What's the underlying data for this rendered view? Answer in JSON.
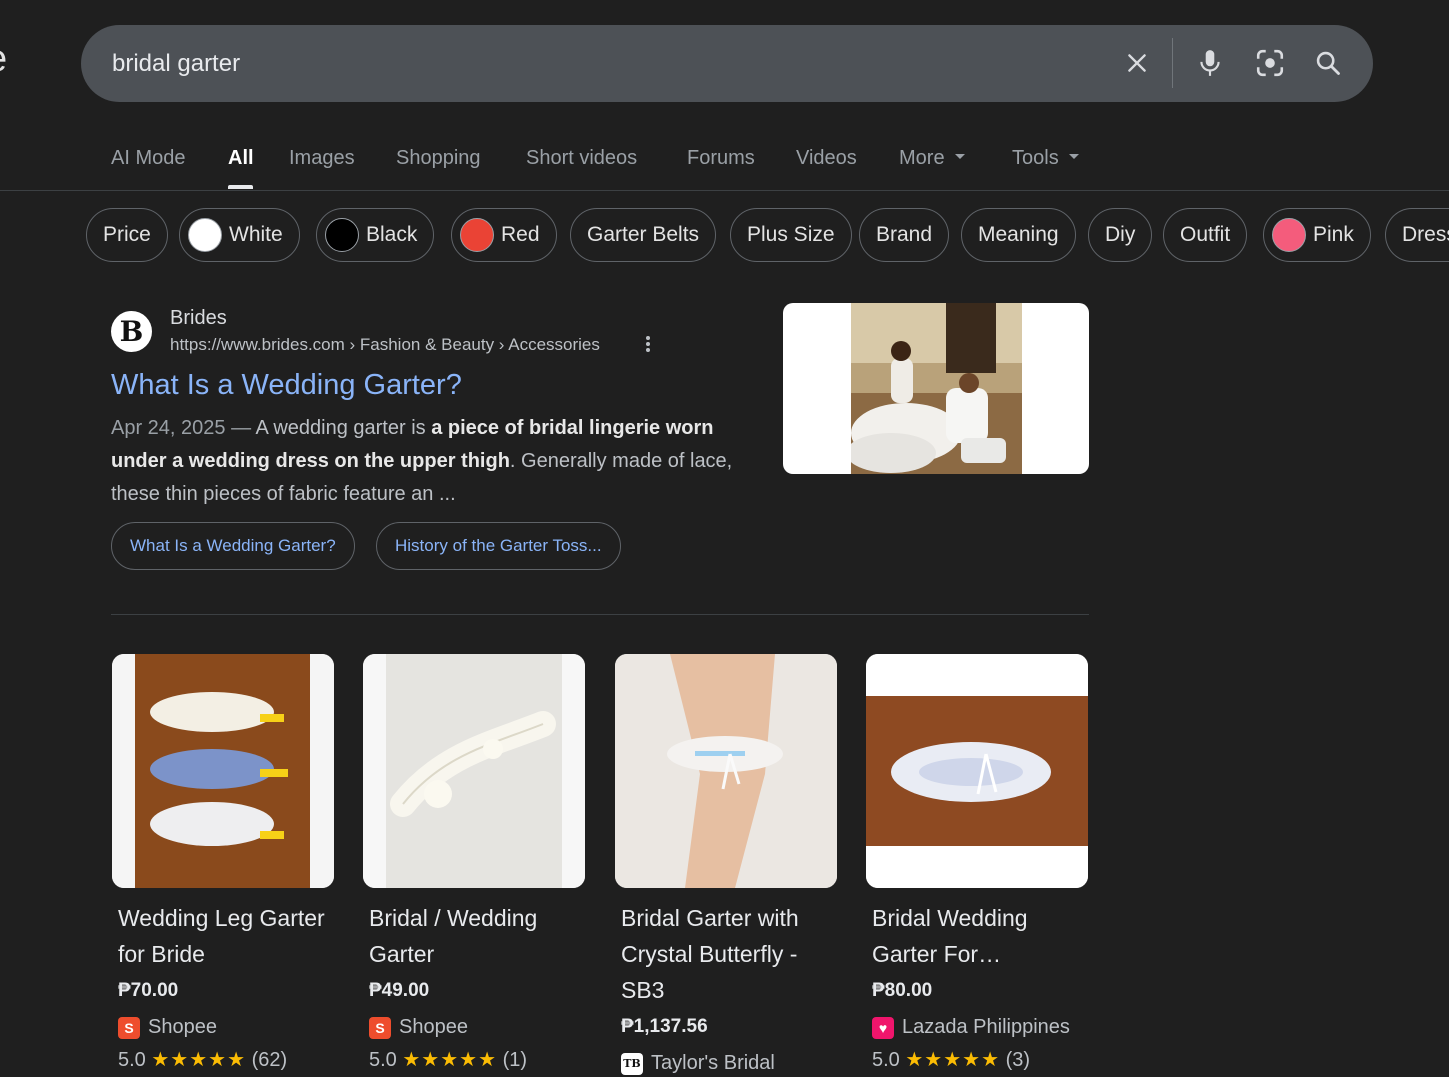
{
  "logo_fragment": "e",
  "search": {
    "query": "bridal garter",
    "icons": [
      "close-icon",
      "microphone-icon",
      "lens-icon",
      "search-icon"
    ]
  },
  "tabs": [
    {
      "label": "AI Mode"
    },
    {
      "label": "All",
      "active": true
    },
    {
      "label": "Images"
    },
    {
      "label": "Shopping"
    },
    {
      "label": "Short videos"
    },
    {
      "label": "Forums"
    },
    {
      "label": "Videos"
    },
    {
      "label": "More"
    },
    {
      "label": "Tools"
    }
  ],
  "chips": [
    {
      "label": "Price"
    },
    {
      "label": "White",
      "swatch": "#ffffff"
    },
    {
      "label": "Black",
      "swatch": "#000000"
    },
    {
      "label": "Red",
      "swatch": "#ea4335"
    },
    {
      "label": "Garter Belts"
    },
    {
      "label": "Plus Size"
    },
    {
      "label": "Brand"
    },
    {
      "label": "Meaning"
    },
    {
      "label": "Diy"
    },
    {
      "label": "Outfit"
    },
    {
      "label": "Pink",
      "swatch": "#f45c7c"
    },
    {
      "label": "Dress"
    }
  ],
  "result": {
    "favicon_letter": "B",
    "site_name": "Brides",
    "url": "https://www.brides.com › Fashion & Beauty › Accessories",
    "title": "What Is a Wedding Garter?",
    "snippet": {
      "date": "Apr 24, 2025",
      "sep": " — ",
      "text1": "A wedding garter is ",
      "bold1": "a piece of bridal lingerie worn under a wedding dress on the upper thigh",
      "text2": ". Generally made of lace, these thin pieces of fabric feature an ..."
    },
    "sitelinks": [
      "What Is a Wedding Garter?",
      "History of the Garter Toss..."
    ]
  },
  "products": [
    {
      "title": "Wedding Leg Garter for Bride",
      "price": "₱70.00",
      "store": "Shopee",
      "store_icon": "S",
      "store_color": "#ee4d2d",
      "rating": "5.0",
      "stars": "★★★★★",
      "reviews": "(62)"
    },
    {
      "title": "Bridal / Wedding Garter",
      "price": "₱49.00",
      "store": "Shopee",
      "store_icon": "S",
      "store_color": "#ee4d2d",
      "rating": "5.0",
      "stars": "★★★★★",
      "reviews": "(1)"
    },
    {
      "title": "Bridal Garter with Crystal Butterfly - SB3",
      "price": "₱1,137.56",
      "store": "Taylor's Bridal",
      "store_icon": "TB",
      "store_color": "#ffffff",
      "rating": "",
      "stars": "",
      "reviews": ""
    },
    {
      "title": "Bridal Wedding Garter For…",
      "price": "₱80.00",
      "store": "Lazada Philippines",
      "store_icon": "♥",
      "store_color": "#f0156c",
      "rating": "5.0",
      "stars": "★★★★★",
      "reviews": "(3)"
    }
  ],
  "colors": {
    "background": "#1f1f1f",
    "searchbar": "#4d5156",
    "link": "#8ab4f8",
    "star": "#fbbc04"
  }
}
